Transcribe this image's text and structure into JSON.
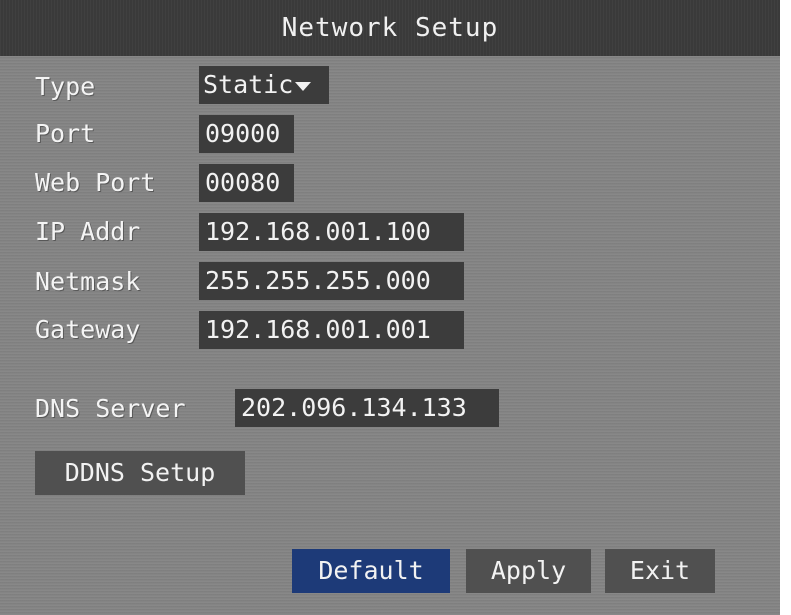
{
  "header": {
    "title": "Network Setup"
  },
  "form": {
    "type": {
      "label": "Type",
      "value": "Static"
    },
    "port": {
      "label": "Port",
      "value": "09000"
    },
    "web_port": {
      "label": "Web Port",
      "value": "00080"
    },
    "ip_addr": {
      "label": "IP Addr",
      "value": "192.168.001.100"
    },
    "netmask": {
      "label": "Netmask",
      "value": "255.255.255.000"
    },
    "gateway": {
      "label": "Gateway",
      "value": "192.168.001.001"
    },
    "dns_server": {
      "label": "DNS Server",
      "value": "202.096.134.133"
    }
  },
  "buttons": {
    "ddns_setup": "DDNS Setup",
    "default": "Default",
    "apply": "Apply",
    "exit": "Exit"
  },
  "colors": {
    "background": "#848484",
    "title_bar": "#3a3a3a",
    "field": "#3c3c3c",
    "button": "#505050",
    "selected_button": "#1d3a78",
    "text": "#f2f2f2"
  }
}
